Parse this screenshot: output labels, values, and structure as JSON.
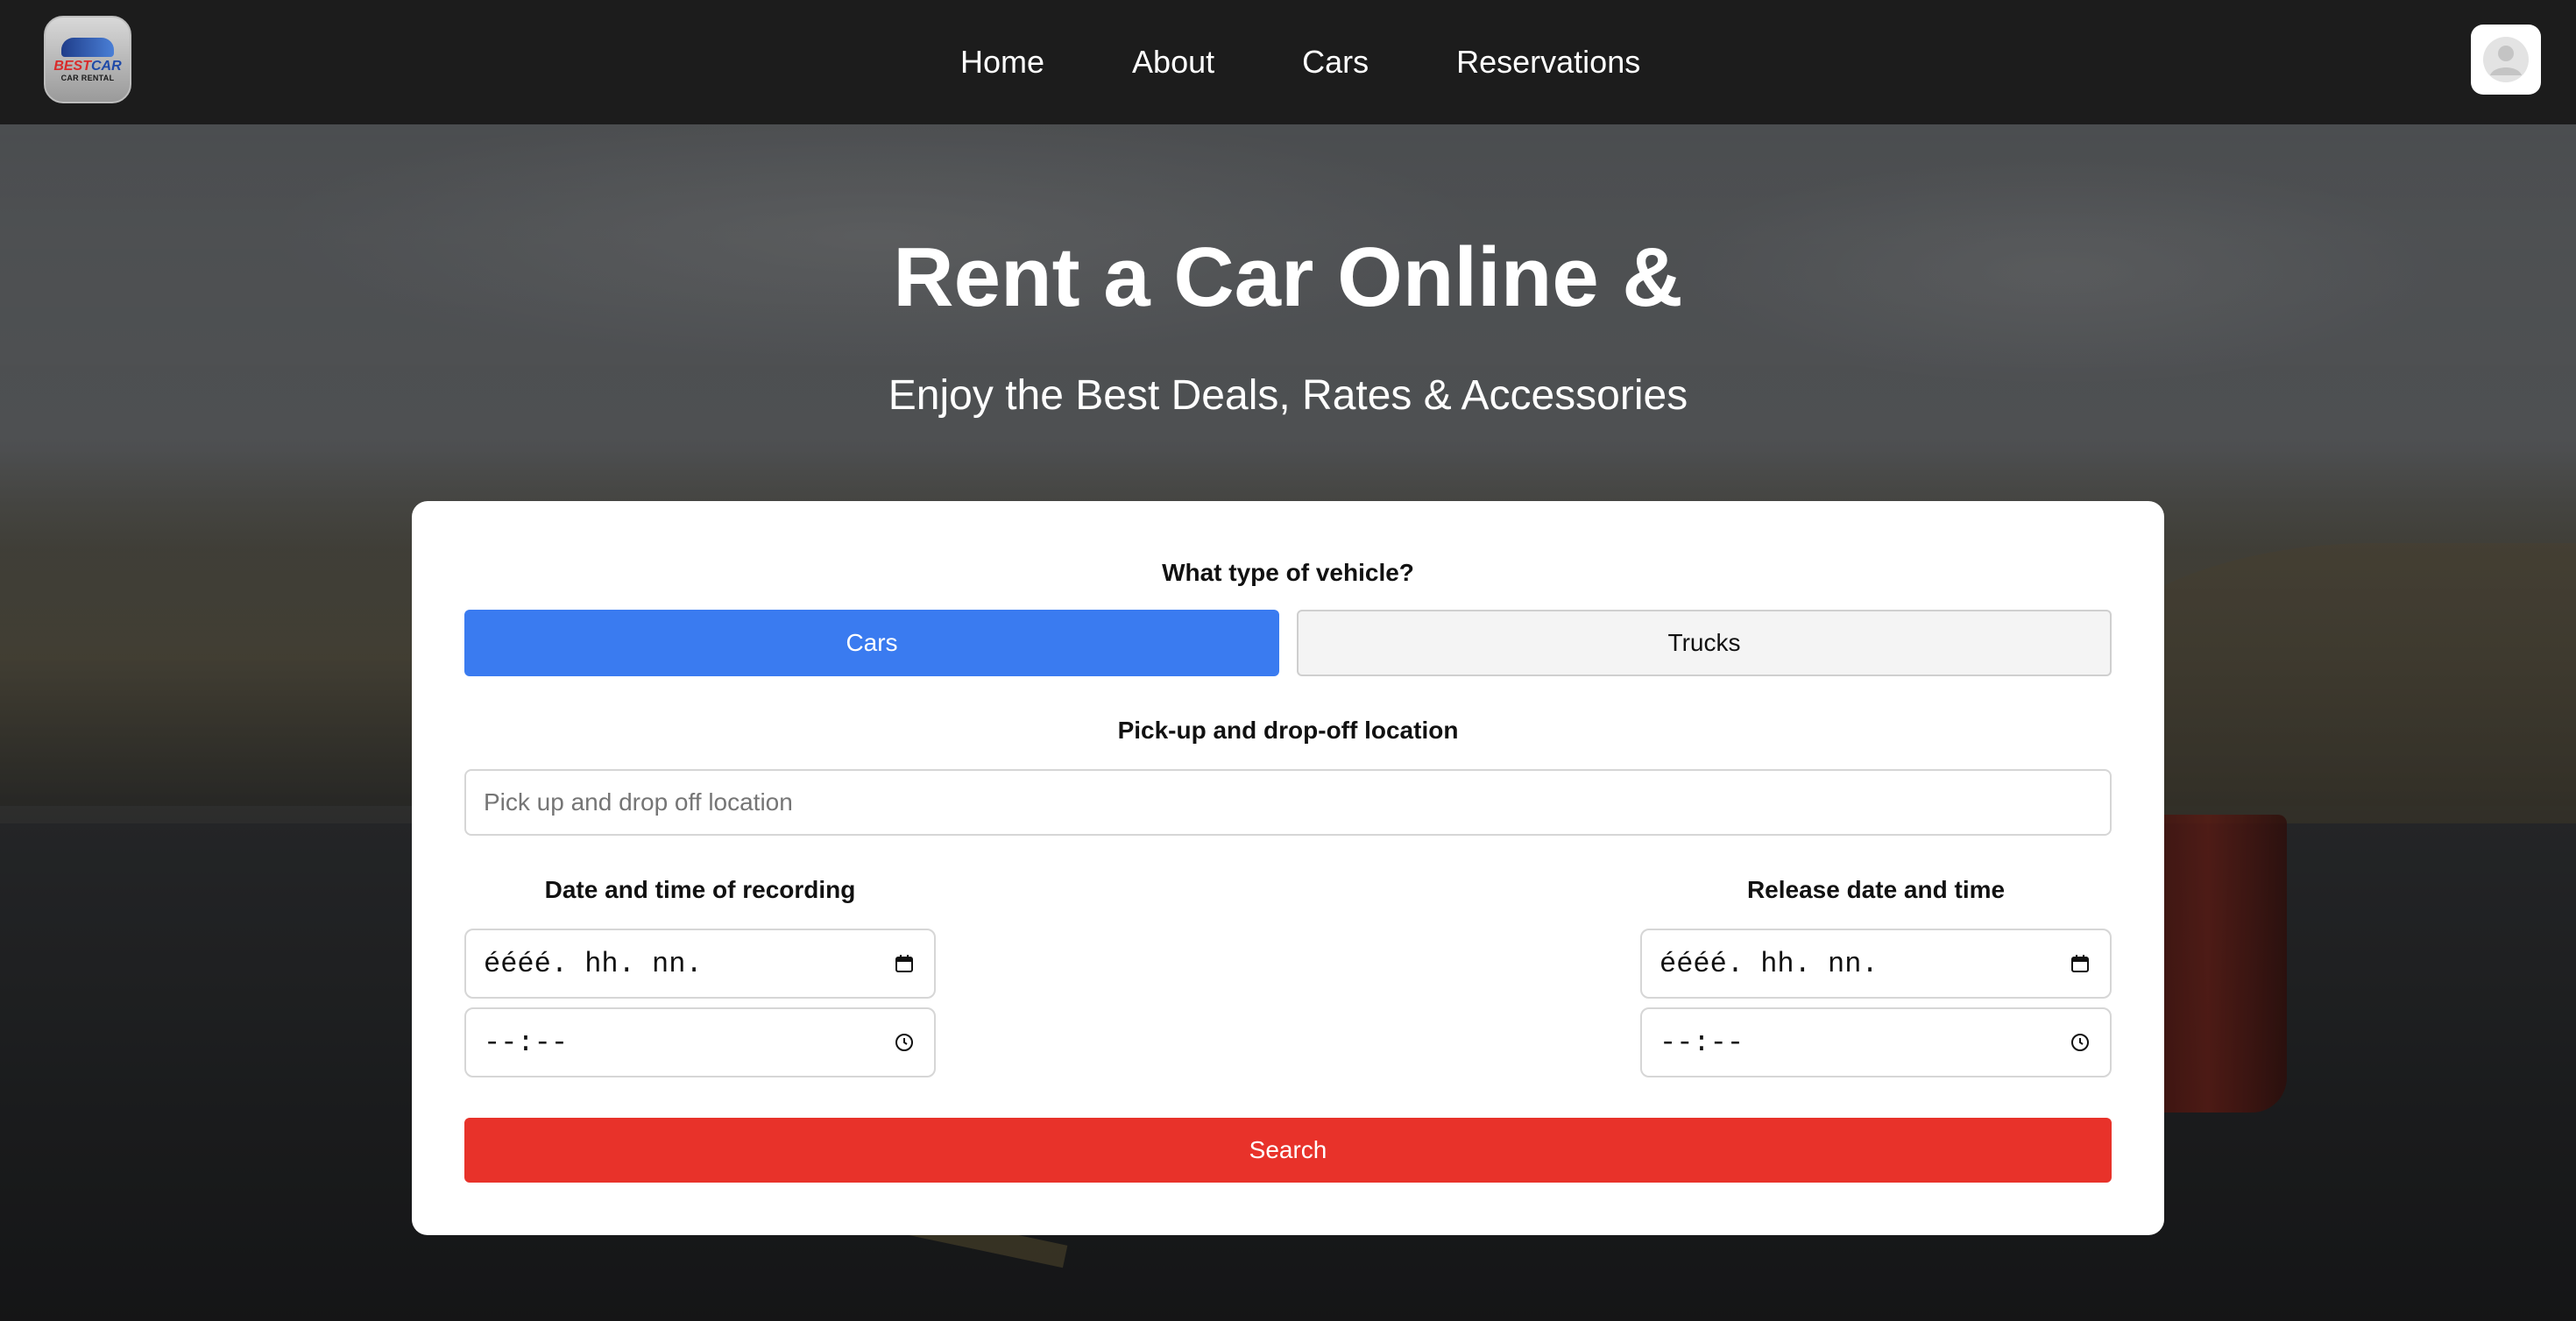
{
  "nav": {
    "logo": {
      "line1_a": "BEST",
      "line1_b": "CAR",
      "line2": "CAR RENTAL"
    },
    "links": [
      "Home",
      "About",
      "Cars",
      "Reservations"
    ]
  },
  "hero": {
    "title": "Rent a Car Online &",
    "subtitle": "Enjoy the Best Deals, Rates & Accessories"
  },
  "form": {
    "vehicle_label": "What type of vehicle?",
    "vehicle_options": [
      "Cars",
      "Trucks"
    ],
    "vehicle_selected": "Cars",
    "location_label": "Pick-up and drop-off location",
    "location_placeholder": "Pick up and drop off location",
    "pickup_label": "Date and time of recording",
    "release_label": "Release date and time",
    "date_placeholder": "éééé. hh. nn.",
    "time_placeholder": "--:--",
    "search_label": "Search"
  },
  "colors": {
    "primary": "#3a7bf0",
    "search": "#e8322a",
    "navbar": "#1c1c1c"
  },
  "icons": {
    "date": "calendar-icon",
    "time": "clock-icon",
    "avatar": "user-avatar-icon"
  }
}
